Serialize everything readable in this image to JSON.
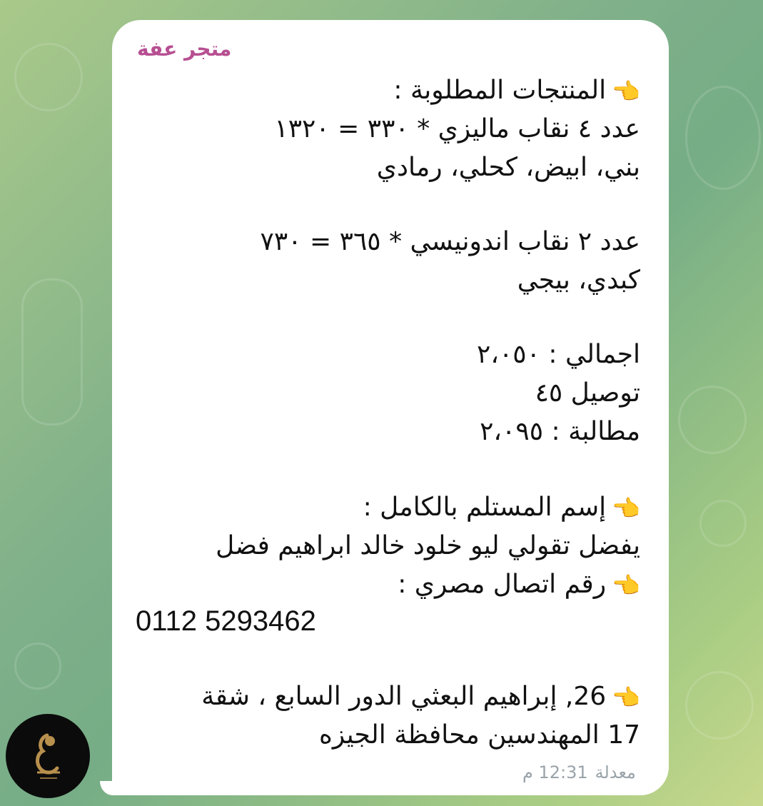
{
  "chat": {
    "background_colors": [
      "#a9c98a",
      "#76ad86",
      "#c7d88c"
    ]
  },
  "message": {
    "sender": "متجر عفة",
    "sender_color": "#b74f92",
    "lines": [
      {
        "icon": "pointing-hand-icon",
        "text": "المنتجات المطلوبة :"
      },
      {
        "text": "عدد ٤ نقاب ماليزي * ٣٣٠ = ١٣٢٠"
      },
      {
        "text": "بني، ابيض، كحلي، رمادي"
      },
      {
        "text": "عدد ٢ نقاب اندونيسي * ٣٦٥ = ٧٣٠"
      },
      {
        "text": "كبدي، بيجي"
      },
      {
        "text": "اجمالي : ٢،٠٥٠"
      },
      {
        "text": "توصيل ٤٥"
      },
      {
        "text": "مطالبة : ٢،٠٩٥"
      },
      {
        "icon": "pointing-hand-icon",
        "text": "إسم المستلم بالكامل :"
      },
      {
        "text": "يفضل تقولي ليو خلود خالد ابراهيم فضل"
      },
      {
        "icon": "pointing-hand-icon",
        "text": "رقم اتصال مصري :"
      },
      {
        "text": "0112 5293462"
      },
      {
        "icon": "pointing-hand-icon",
        "text": "26, إبراهيم البعثي الدور السابع ، شقة"
      },
      {
        "text": "17 المهندسين محافظة الجيزه"
      }
    ],
    "edited_label": "معدلة",
    "time": "12:31 م"
  },
  "avatar": {
    "icon": "store-logo-icon"
  }
}
